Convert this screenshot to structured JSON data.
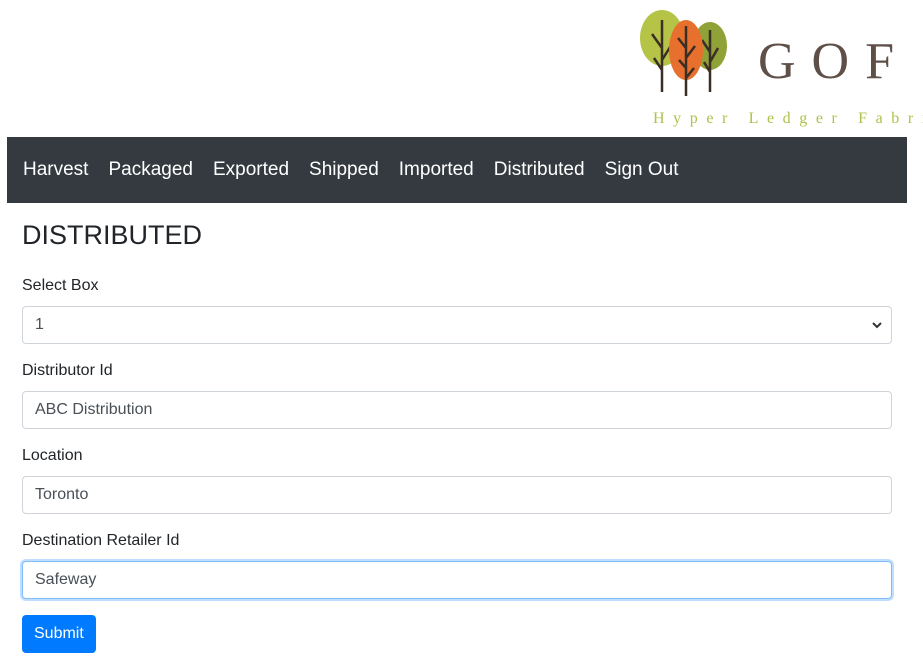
{
  "header": {
    "brand": "GOF",
    "tagline": "Hyper Ledger Fabric",
    "logo_icon": "trees-logo-icon"
  },
  "nav": {
    "items": [
      {
        "label": "Harvest"
      },
      {
        "label": "Packaged"
      },
      {
        "label": "Exported"
      },
      {
        "label": "Shipped"
      },
      {
        "label": "Imported"
      },
      {
        "label": "Distributed"
      },
      {
        "label": "Sign Out"
      }
    ]
  },
  "page": {
    "title": "DISTRIBUTED"
  },
  "form": {
    "select_box": {
      "label": "Select Box",
      "value": "1"
    },
    "distributor_id": {
      "label": "Distributor Id",
      "value": "ABC Distribution"
    },
    "location": {
      "label": "Location",
      "value": "Toronto"
    },
    "destination_retailer_id": {
      "label": "Destination Retailer Id",
      "value": "Safeway"
    },
    "submit_label": "Submit"
  },
  "colors": {
    "navbar_bg": "#343a40",
    "primary": "#007bff",
    "brand_text": "#5e5048",
    "tagline_text": "#b1c04a"
  }
}
